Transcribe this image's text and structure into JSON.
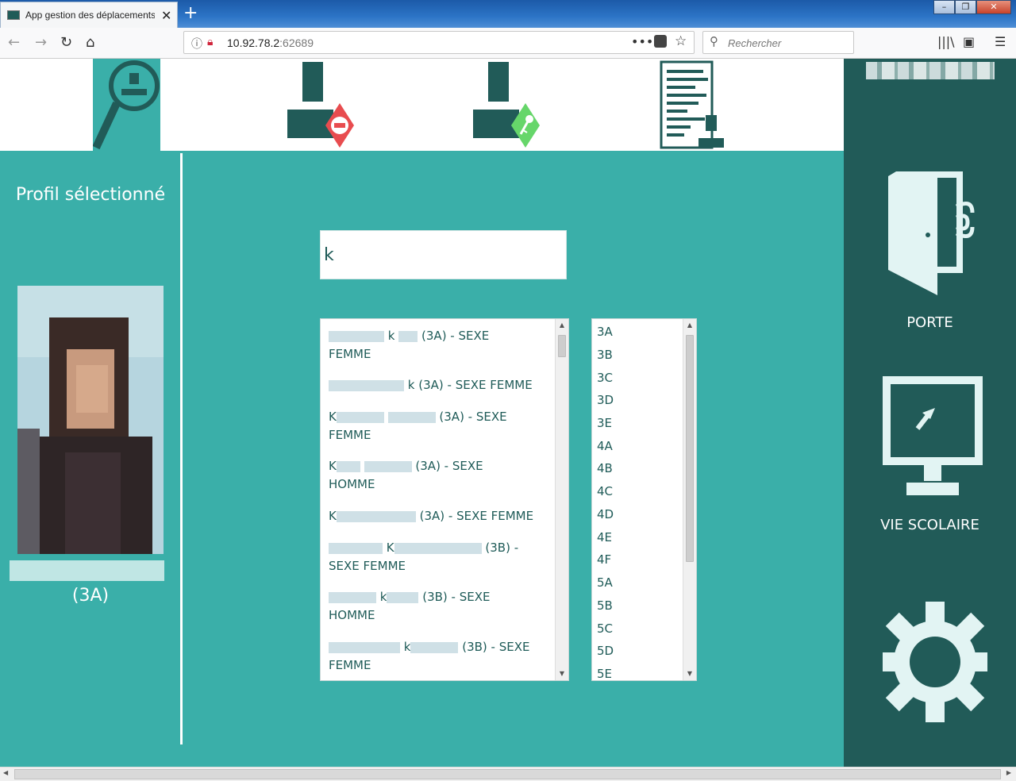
{
  "browser": {
    "tab_title": "App gestion des déplacements",
    "url_host": "10.92.78.2",
    "url_port": ":62689",
    "search_placeholder": "Rechercher"
  },
  "profile": {
    "title": "Profil sélectionné",
    "class": "(3A)"
  },
  "search": {
    "value": "k"
  },
  "students": [
    {
      "l1": "k",
      "l1b": "(3A) - SEXE",
      "l2": "FEMME"
    },
    {
      "l1": "k",
      "l1b": "(3A) - SEXE FEMME",
      "l2": ""
    },
    {
      "l1": "K",
      "l1b": "(3A) - SEXE",
      "l2": "FEMME"
    },
    {
      "l1": "K",
      "l1b": "(3A) - SEXE",
      "l2": "HOMME"
    },
    {
      "l1": "K",
      "l1b": "(3A) - SEXE FEMME",
      "l2": ""
    },
    {
      "l1": "K",
      "l1b": "(3B) -",
      "l2": "SEXE FEMME"
    },
    {
      "l1": "k",
      "l1b": "(3B) - SEXE",
      "l2": "HOMME"
    },
    {
      "l1": "k",
      "l1b": "(3B) - SEXE",
      "l2": "FEMME"
    }
  ],
  "classes": [
    "3A",
    "3B",
    "3C",
    "3D",
    "3E",
    "4A",
    "4B",
    "4C",
    "4D",
    "4E",
    "4F",
    "5A",
    "5B",
    "5C",
    "5D",
    "5E"
  ],
  "sidebar": {
    "door_label": "PORTE",
    "school_label": "VIE SCOLAIRE"
  },
  "colors": {
    "teal": "#3aafa9",
    "dark_teal": "#215b58",
    "red": "#e84c4f",
    "green": "#66d66a"
  }
}
